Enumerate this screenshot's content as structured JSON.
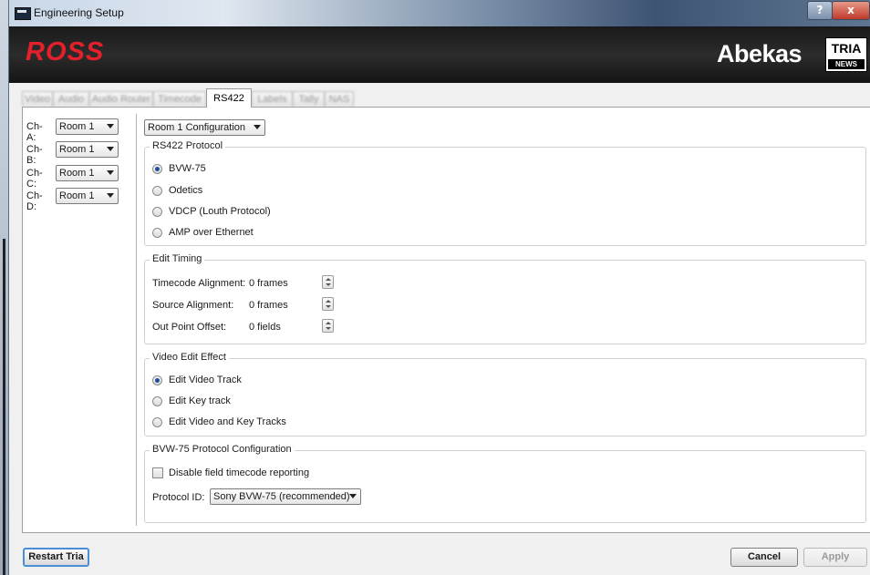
{
  "window": {
    "title": "Engineering Setup",
    "help_label": "?",
    "close_label": "x"
  },
  "brand": {
    "ross": "ROSS",
    "abekas": "Abekas",
    "tria": "TRIA",
    "news": "NEWS"
  },
  "tabs": [
    {
      "label": "Video",
      "active": false
    },
    {
      "label": "Audio",
      "active": false
    },
    {
      "label": "Audio Router",
      "active": false
    },
    {
      "label": "Timecode",
      "active": false
    },
    {
      "label": "RS422",
      "active": true
    },
    {
      "label": "Labels",
      "active": false
    },
    {
      "label": "Tally",
      "active": false
    },
    {
      "label": "NAS",
      "active": false
    }
  ],
  "channels": [
    {
      "label": "Ch-A:",
      "value": "Room 1"
    },
    {
      "label": "Ch-B:",
      "value": "Room 1"
    },
    {
      "label": "Ch-C:",
      "value": "Room 1"
    },
    {
      "label": "Ch-D:",
      "value": "Room 1"
    }
  ],
  "config_select": "Room 1 Configuration",
  "rs422_protocol": {
    "title": "RS422 Protocol",
    "options": [
      "BVW-75",
      "Odetics",
      "VDCP (Louth Protocol)",
      "AMP over Ethernet"
    ],
    "selected": "BVW-75"
  },
  "edit_timing": {
    "title": "Edit Timing",
    "fields": [
      {
        "label": "Timecode Alignment:",
        "value": "0 frames"
      },
      {
        "label": "Source Alignment:",
        "value": "0 frames"
      },
      {
        "label": "Out Point Offset:",
        "value": "0 fields"
      }
    ]
  },
  "video_edit_effect": {
    "title": "Video Edit Effect",
    "options": [
      "Edit Video Track",
      "Edit Key track",
      "Edit Video and Key Tracks"
    ],
    "selected": "Edit Video Track"
  },
  "bvw_config": {
    "title": "BVW-75 Protocol Configuration",
    "checkbox_label": "Disable field timecode reporting",
    "checkbox_checked": false,
    "protocol_label": "Protocol ID:",
    "protocol_value": "Sony BVW-75 (recommended)"
  },
  "buttons": {
    "restart": "Restart Tria",
    "cancel": "Cancel",
    "apply": "Apply"
  }
}
